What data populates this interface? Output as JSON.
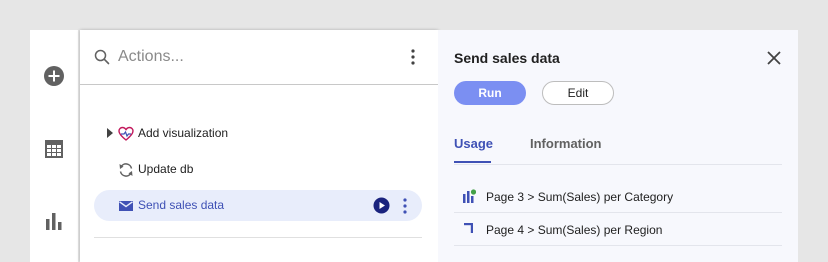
{
  "search": {
    "placeholder": "Actions..."
  },
  "rail": {
    "icons": [
      "add-circle-icon",
      "table-icon",
      "bar-chart-icon"
    ]
  },
  "tree": {
    "items": [
      {
        "label": "Add visualization",
        "icon": "heart-visualization-icon",
        "expandable": true
      },
      {
        "label": "Update db",
        "icon": "refresh-icon"
      },
      {
        "label": "Send sales data",
        "icon": "mail-icon",
        "selected": true
      }
    ]
  },
  "details": {
    "title": "Send sales data",
    "run_label": "Run",
    "edit_label": "Edit",
    "tabs": [
      {
        "label": "Usage",
        "active": true
      },
      {
        "label": "Information",
        "active": false
      }
    ],
    "usage": [
      {
        "text": "Page 3 > Sum(Sales) per Category",
        "icon": "bar-chart-usage-icon"
      },
      {
        "text": "Page 4 > Sum(Sales) per Region",
        "icon": "map-corner-icon"
      }
    ]
  },
  "colors": {
    "accent": "#3f51b5",
    "run_button": "#7b8ff2",
    "selected_row": "#e8edfb"
  }
}
